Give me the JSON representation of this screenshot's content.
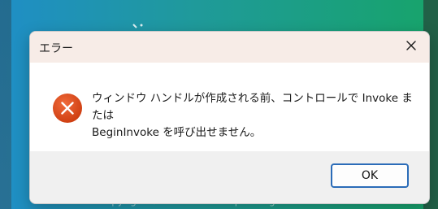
{
  "background": {
    "footer_text": "Copyright © 2016 SSL Group. All rights reserved."
  },
  "dialog": {
    "title": "エラー",
    "close_icon": "close-icon",
    "error_icon": "error-icon",
    "message_line1": "ウィンドウ ハンドルが作成される前、コントロールで Invoke または",
    "message_line2": "BeginInvoke を呼び出せません。",
    "ok_label": "OK",
    "colors": {
      "titlebar": "#f7ece7",
      "error_icon": "#d94b1f",
      "ok_border": "#2b6cb8",
      "footer": "#f0f0f0"
    }
  }
}
